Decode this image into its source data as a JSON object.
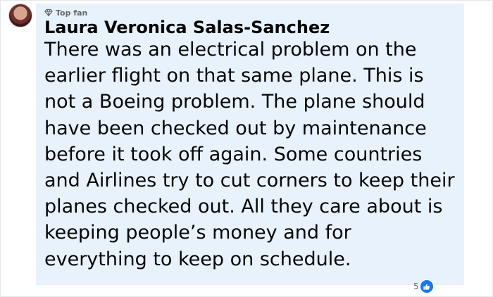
{
  "comment": {
    "badge_icon": "diamond-icon",
    "badge_label": "Top fan",
    "author": "Laura Veronica Salas-Sanchez",
    "text": "There was an electrical problem on the earlier flight on that same plane. This is not a Boeing problem. The plane should have been checked out by maintenance before it took off again. Some countries and Airlines try to cut corners to keep their planes checked out. All they care about is keeping people’s money and for everything to keep on schedule.",
    "reaction_count": "5",
    "reaction_icon": "like-icon"
  },
  "colors": {
    "bubble_background": "#e8f2fd",
    "text": "#050505",
    "secondary_text": "#65676b",
    "like_blue": "#1877f2"
  }
}
